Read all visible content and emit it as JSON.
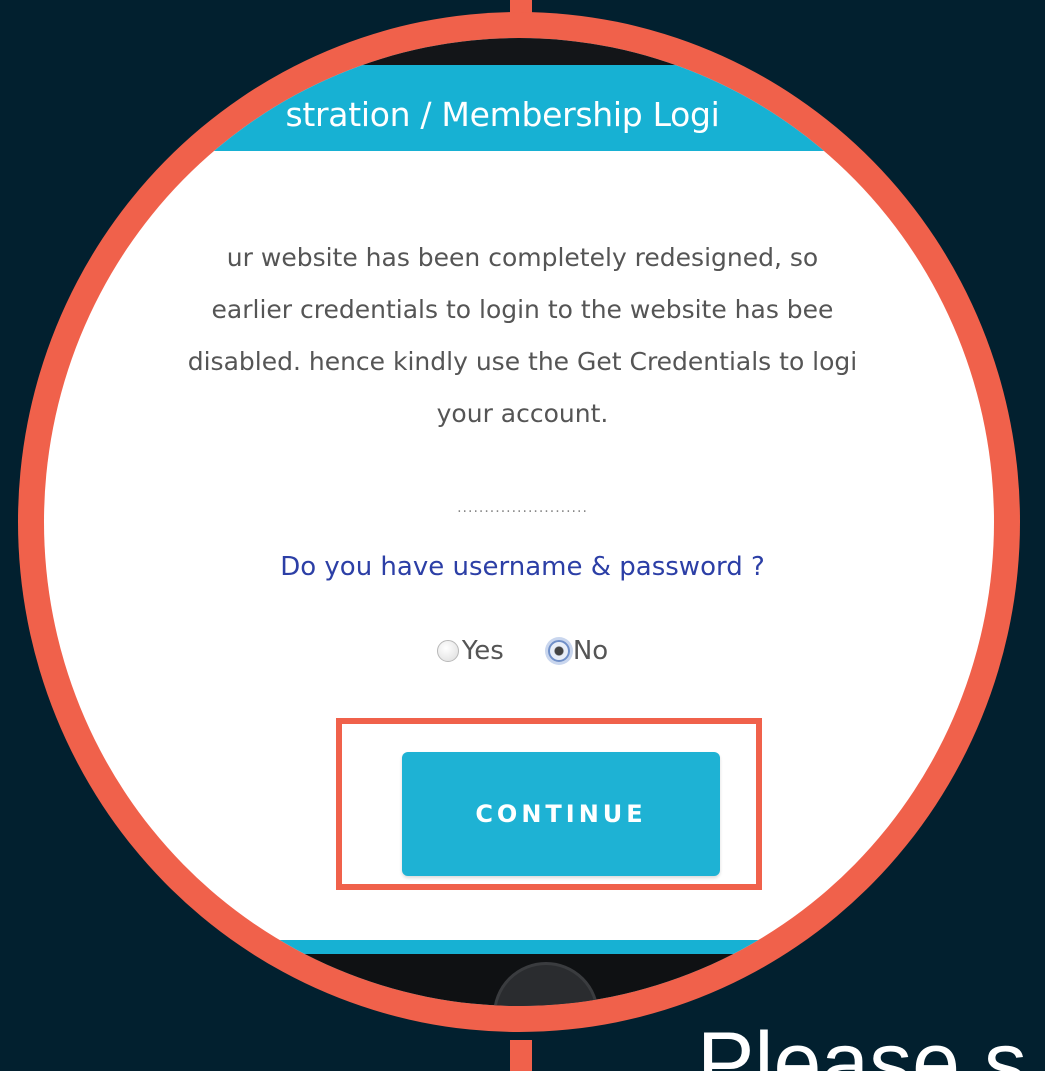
{
  "header": {
    "title": "stration / Membership Logi"
  },
  "message": {
    "line1": "ur website has been completely redesigned, so",
    "line2": "earlier credentials to login to the website has bee",
    "line3": "disabled. hence kindly use the Get Credentials to logi",
    "line4": "your account."
  },
  "separator": "........................",
  "question": "Do you have username & password ?",
  "radios": {
    "yes_label": "Yes",
    "no_label": "No",
    "selected": "No"
  },
  "continue_button": {
    "label": "CONTINUE"
  },
  "caption": "Please s",
  "colors": {
    "background": "#02202f",
    "highlight": "#f0614b",
    "accent": "#17b1d3",
    "question_text": "#2c3fa6"
  }
}
